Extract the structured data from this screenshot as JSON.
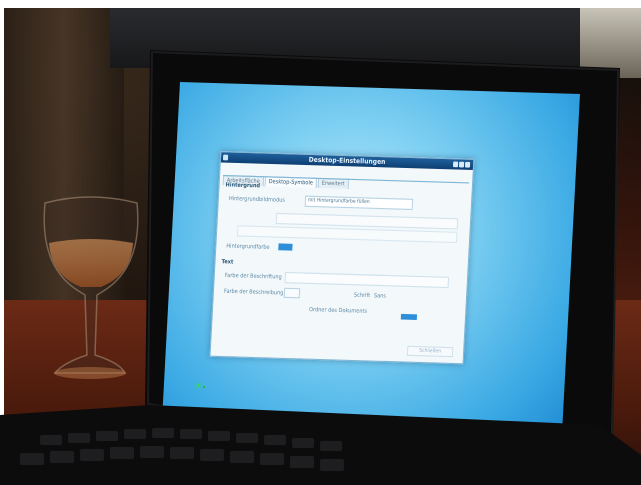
{
  "scene": {
    "description_colors": {
      "screen_light": "#bde8fb",
      "screen_dark": "#1b86d0",
      "bezel": "#0b0b0c",
      "table": "#6b2a15"
    }
  },
  "dialog": {
    "title": "Desktop-Einstellungen",
    "tabs": [
      {
        "label": "Arbeitsfläche",
        "active": false
      },
      {
        "label": "Desktop-Symbole",
        "active": true
      },
      {
        "label": "Erweitert",
        "active": false
      }
    ],
    "section_background": "Hintergrund",
    "label_wallpaper_mode": "Hintergrundbildmodus",
    "wallpaper_mode_value": "mit Hintergrundfarbe füllen",
    "label_section_text": "Text",
    "label_text_color": "Farbe der Beschriftung",
    "label_shadow_color": "Farbe der Beschreibung",
    "label_font": "Schrift",
    "font_value": "Sans",
    "label_background_color": "Hintergrundfarbe",
    "label_show_docs": "Ordner des Dokuments",
    "close_label": "Schließen"
  }
}
